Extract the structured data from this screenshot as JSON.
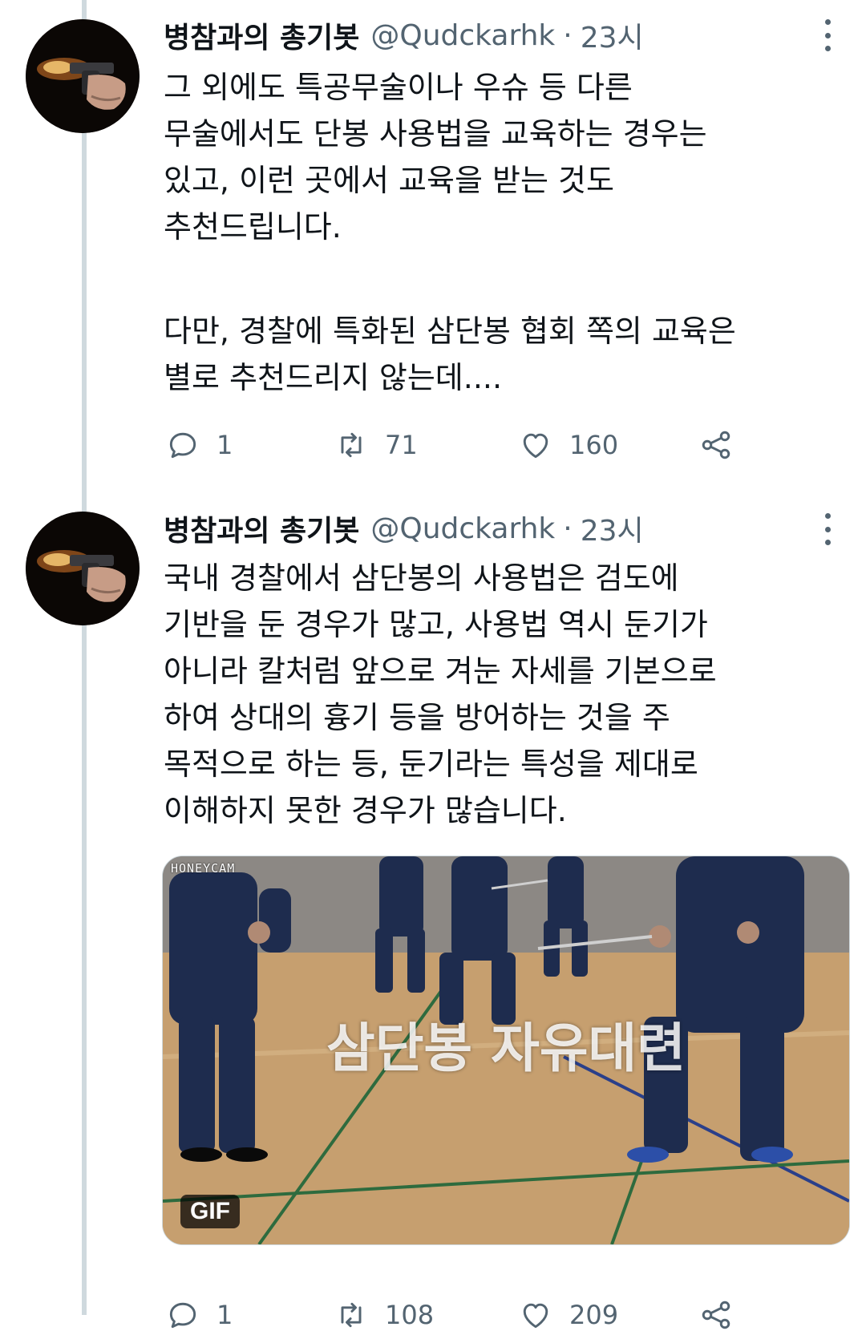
{
  "tweets": [
    {
      "author_name": "병참과의 총기봇",
      "handle": "@Qudckarhk",
      "separator": "·",
      "time": "23시",
      "text_lines": [
        "그 외에도 특공무술이나 우슈 등 다른",
        "무술에서도 단봉 사용법을 교육하는 경우는",
        "있고, 이런 곳에서 교육을 받는 것도",
        "추천드립니다.",
        "",
        "다만, 경찰에 특화된 삼단봉 협회 쪽의 교육은",
        "별로 추천드리지 않는데...."
      ],
      "replies": "1",
      "retweets": "71",
      "likes": "160"
    },
    {
      "author_name": "병참과의 총기봇",
      "handle": "@Qudckarhk",
      "separator": "·",
      "time": "23시",
      "text_lines": [
        "국내 경찰에서 삼단봉의 사용법은 검도에",
        "기반을 둔 경우가 많고, 사용법 역시 둔기가",
        "아니라 칼처럼 앞으로 겨눈 자세를 기본으로",
        "하여 상대의 흉기 등을 방어하는 것을 주",
        "목적으로 하는 등, 둔기라는 특성을 제대로",
        "이해하지 못한 경우가 많습니다."
      ],
      "media": {
        "watermark": "HONEYCAM",
        "caption": "삼단봉 자유대련",
        "badge": "GIF"
      },
      "replies": "1",
      "retweets": "108",
      "likes": "209"
    }
  ],
  "icons": {
    "reply": "reply-icon",
    "retweet": "retweet-icon",
    "like": "heart-icon",
    "share": "share-icon",
    "more": "more-icon"
  },
  "colors": {
    "text": "#0f1419",
    "secondary": "#536471",
    "thread_line": "#cfd9de"
  }
}
